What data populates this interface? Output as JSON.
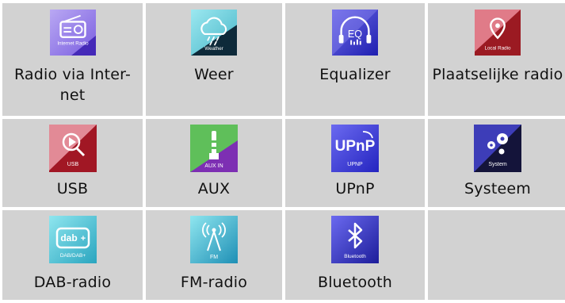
{
  "tiles": [
    {
      "label": "Radio via Internet",
      "display": "Radio via Inter-\nnet",
      "icon": "internet-radio-icon",
      "icon_caption": "Internet Radio"
    },
    {
      "label": "Weer",
      "icon": "weather-icon",
      "icon_caption": "Weather"
    },
    {
      "label": "Equalizer",
      "icon": "equalizer-icon",
      "icon_caption": "EQ"
    },
    {
      "label": "Plaatselijke radio",
      "icon": "local-radio-icon",
      "icon_caption": "Local Radio"
    },
    {
      "label": "USB",
      "icon": "usb-icon",
      "icon_caption": "USB"
    },
    {
      "label": "AUX",
      "icon": "aux-in-icon",
      "icon_caption": "AUX IN"
    },
    {
      "label": "UPnP",
      "icon": "upnp-icon",
      "icon_caption": "UPNP"
    },
    {
      "label": "Systeem",
      "icon": "system-icon",
      "icon_caption": "System"
    },
    {
      "label": "DAB-radio",
      "icon": "dab-radio-icon",
      "icon_caption": "DAB/DAB+"
    },
    {
      "label": "FM-radio",
      "icon": "fm-radio-icon",
      "icon_caption": "FM"
    },
    {
      "label": "Bluetooth",
      "icon": "bluetooth-icon",
      "icon_caption": "Bluetooth"
    }
  ],
  "colors": {
    "tile_background": "#d2d2d2",
    "page_background": "#ffffff",
    "text": "#111111"
  }
}
